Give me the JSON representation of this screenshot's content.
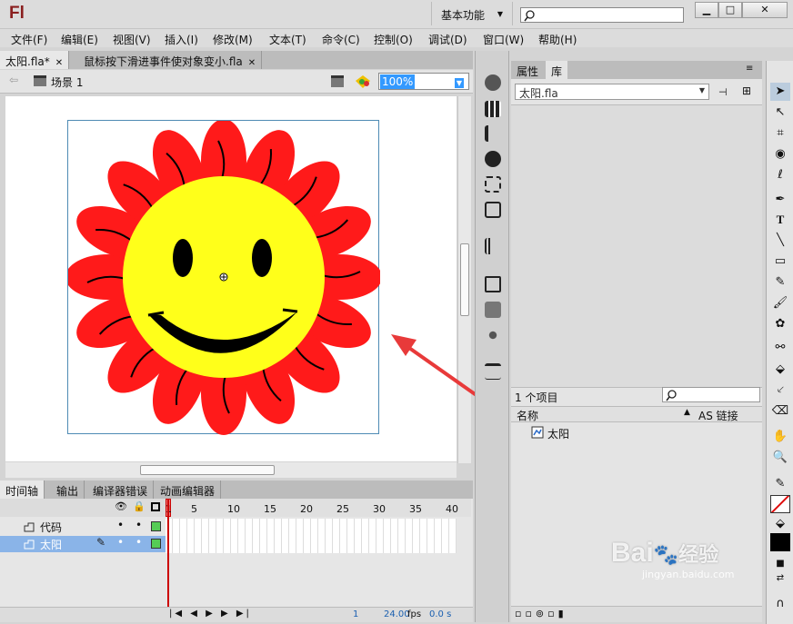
{
  "app": {
    "logo": "Fl",
    "workspace": "基本功能",
    "search_placeholder": ""
  },
  "window": {
    "minimize": "▁",
    "maximize": "□",
    "close": "✕"
  },
  "menu": [
    "文件(F)",
    "编辑(E)",
    "视图(V)",
    "插入(I)",
    "修改(M)",
    "文本(T)",
    "命令(C)",
    "控制(O)",
    "调试(D)",
    "窗口(W)",
    "帮助(H)"
  ],
  "doc_tabs": [
    {
      "label": "太阳.fla*",
      "active": true
    },
    {
      "label": "鼠标按下滑进事件使对象变小.fla",
      "active": false
    }
  ],
  "edit_bar": {
    "scene": "场景 1",
    "zoom": "100%"
  },
  "timeline": {
    "tabs": [
      "时间轴",
      "输出",
      "编译器错误",
      "动画编辑器"
    ],
    "frame_numbers": [
      "1",
      "5",
      "10",
      "15",
      "20",
      "25",
      "30",
      "35",
      "40"
    ],
    "layers": [
      {
        "name": "代码",
        "selected": false
      },
      {
        "name": "太阳",
        "selected": true
      }
    ],
    "current_frame": "1",
    "fps": "24.00",
    "fps_unit": "fps",
    "time": "0.0 s"
  },
  "panel": {
    "tabs": [
      "属性",
      "库"
    ],
    "library_file": "太阳.fla",
    "item_count": "1 个项目",
    "col_name": "名称",
    "col_linkage": "AS 链接",
    "items": [
      {
        "name": "太阳",
        "icon": "movieclip-icon"
      }
    ]
  },
  "colors": {
    "petal": "#ff1a1a",
    "face": "#ffff1a",
    "accent": "#3399ff",
    "annotation": "#e83a3a"
  },
  "watermark": {
    "brand": "Bai",
    "brand2": "经验",
    "url": "jingyan.baidu.com"
  }
}
